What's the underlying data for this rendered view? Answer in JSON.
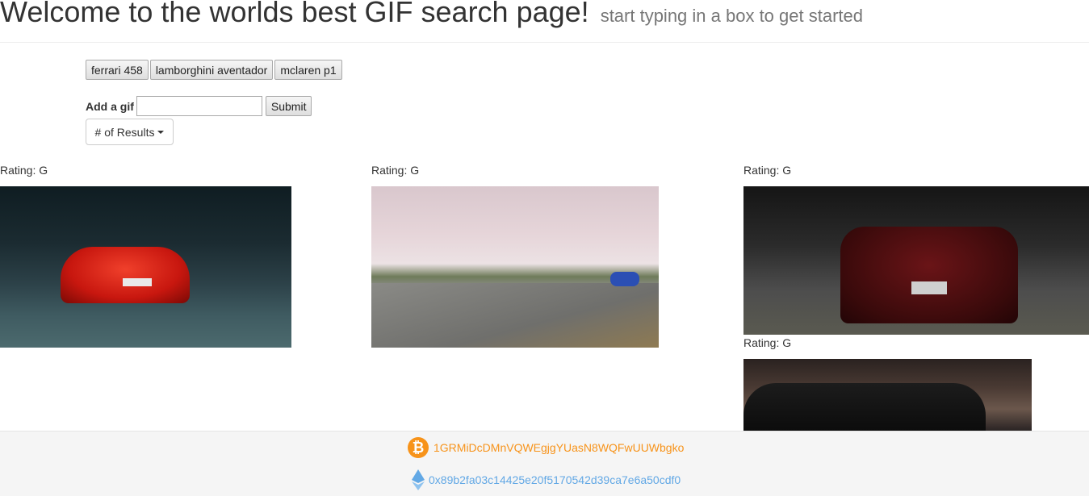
{
  "header": {
    "title": "Welcome to the worlds best GIF search page!",
    "subtitle": "start typing in a box to get started"
  },
  "search_buttons": [
    "ferrari 458",
    "lamborghini aventador",
    "mclaren p1"
  ],
  "add_gif": {
    "label": "Add a gif",
    "input_value": "",
    "submit_label": "Submit"
  },
  "results_dropdown": {
    "label": "# of Results"
  },
  "gifs": [
    {
      "rating": "Rating: G"
    },
    {
      "rating": "Rating: G"
    },
    {
      "rating": "Rating: G"
    },
    {
      "rating": "Rating: G"
    }
  ],
  "footer": {
    "btc_address": "1GRMiDcDMnVQWEgjgYUasN8WQFwUUWbgko",
    "eth_address": "0x89b2fa03c14425e20f5170542d39ca7e6a50cdf0"
  },
  "colors": {
    "btc": "#f7931a",
    "eth": "#62a8e5"
  }
}
